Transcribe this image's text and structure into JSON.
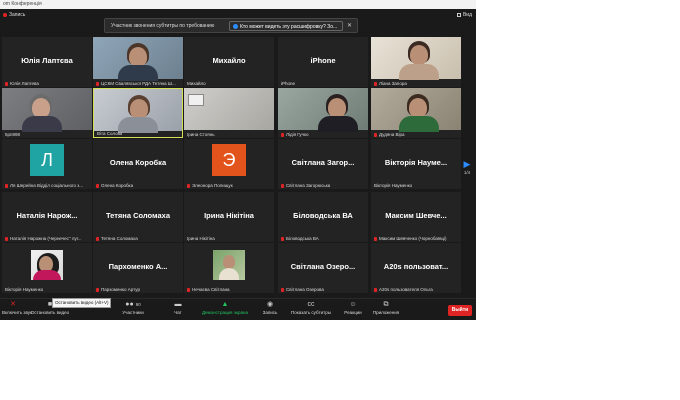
{
  "window": {
    "title": "om Конференція"
  },
  "topbar": {
    "recording_label": "Запись",
    "view_label": "Вид"
  },
  "toast": {
    "message": "Участник звонения субтитры по требованию",
    "button_label": "Кто может видеть эту расшифровку? Зо...",
    "close": "✕"
  },
  "participants": [
    {
      "name": "Юлія Лаптєва",
      "label": "Юлія Лаптева",
      "muted": true
    },
    {
      "name": "",
      "label": "ЦСКМ Свалявської РДА Тетяна Ш...",
      "muted": true
    },
    {
      "name": "Михайло",
      "label": "Михайло",
      "muted": false
    },
    {
      "name": "iPhone",
      "label": "iPhone",
      "muted": false
    },
    {
      "name": "",
      "label": "Ліана Запора",
      "muted": true
    },
    {
      "name": "",
      "label": "5рп898",
      "muted": false
    },
    {
      "name": "",
      "label": "Віта Солова",
      "muted": false
    },
    {
      "name": "",
      "label": "Ірина Стоянь",
      "muted": false
    },
    {
      "name": "",
      "label": "Лідія Гучко",
      "muted": true
    },
    {
      "name": "",
      "label": "Дудяна Віра",
      "muted": true
    },
    {
      "name": "",
      "avatar_letter": "Л",
      "label": "Ля Шерейна Відділ соціального з...",
      "muted": true
    },
    {
      "name": "Олена Коробка",
      "label": "Олена Коробка",
      "muted": true
    },
    {
      "name": "",
      "avatar_letter": "Э",
      "label": "Элеонора Полищук",
      "muted": true
    },
    {
      "name": "Світлана Загор...",
      "label": "Світлана Загорюська",
      "muted": true
    },
    {
      "name": "Вікторія Науме...",
      "label": "Вікторія Науменко",
      "muted": false
    },
    {
      "name": "Наталія Нарож...",
      "label": "Наталія Нарожна (Чернечес'' луг...",
      "muted": true
    },
    {
      "name": "Тетяна Соломаха",
      "label": "Тетяна Соломаха",
      "muted": true
    },
    {
      "name": "Ірина Нікітіна",
      "label": "Ірина Нікітіна",
      "muted": false
    },
    {
      "name": "Біловодська ВА",
      "label": "Біловодська ВА",
      "muted": true
    },
    {
      "name": "Максим Шевче...",
      "label": "Максим Шевченко (Чорнобаївці)",
      "muted": true
    },
    {
      "name": "",
      "label": "Вікторія Науменко",
      "muted": false
    },
    {
      "name": "Пархоменко А...",
      "label": "Пархоменко Артур",
      "muted": true
    },
    {
      "name": "",
      "label": "Нечаєва Світлана",
      "muted": true
    },
    {
      "name": "Світлана Озеро...",
      "label": "Світлана Озерова",
      "muted": true
    },
    {
      "name": "A20s пользоват...",
      "label": "A20s пользователя Ольга",
      "muted": true
    }
  ],
  "pager": {
    "arrow": "▶",
    "page": "1/4"
  },
  "toolbar": {
    "unmute": "Включить звук",
    "stop_video": "Остановить видео",
    "tooltip": "Остановить видео (Alt+V)",
    "participants": "Участники",
    "participants_count": "90",
    "chat": "Чат",
    "share_screen": "Демонстрация экрана",
    "record": "Запись",
    "captions": "Показать субтитры",
    "reactions": "Реакции",
    "apps": "Приложения",
    "leave": "Выйти"
  },
  "icons": [
    "mic-muted-icon",
    "video-camera-icon",
    "participants-icon",
    "chat-icon",
    "share-screen-icon",
    "record-icon",
    "captions-icon",
    "reactions-icon",
    "apps-icon"
  ]
}
